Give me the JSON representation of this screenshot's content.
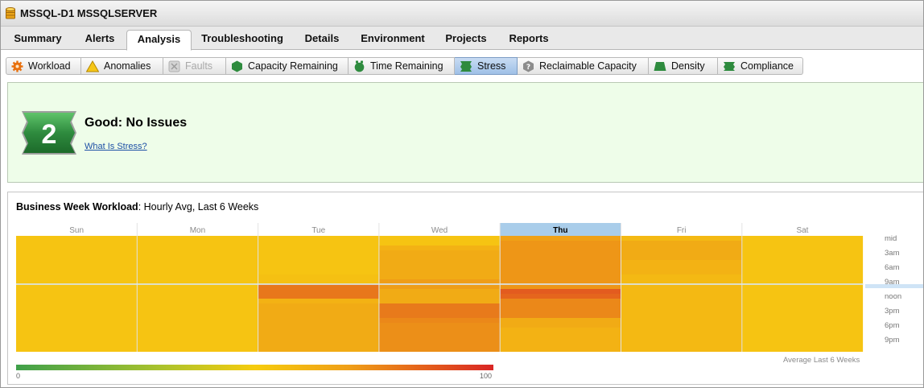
{
  "window": {
    "title": "MSSQL-D1 MSSQLSERVER",
    "icon": "database-icon"
  },
  "main_tabs": [
    {
      "label": "Summary",
      "active": false
    },
    {
      "label": "Alerts",
      "active": false
    },
    {
      "label": "Analysis",
      "active": true
    },
    {
      "label": "Troubleshooting",
      "active": false
    },
    {
      "label": "Details",
      "active": false
    },
    {
      "label": "Environment",
      "active": false
    },
    {
      "label": "Projects",
      "active": false
    },
    {
      "label": "Reports",
      "active": false
    }
  ],
  "sub_tabs": [
    {
      "label": "Workload",
      "icon": "workload-gear-icon",
      "active": false,
      "disabled": false
    },
    {
      "label": "Anomalies",
      "icon": "anomalies-warning-icon",
      "active": false,
      "disabled": false
    },
    {
      "label": "Faults",
      "icon": "faults-icon",
      "active": false,
      "disabled": true
    },
    {
      "label": "Capacity Remaining",
      "icon": "capacity-remaining-icon",
      "active": false,
      "disabled": false
    },
    {
      "label": "Time Remaining",
      "icon": "time-remaining-icon",
      "active": false,
      "disabled": false
    },
    {
      "label": "Stress",
      "icon": "stress-icon",
      "active": true,
      "disabled": false
    },
    {
      "label": "Reclaimable Capacity",
      "icon": "reclaimable-capacity-icon",
      "active": false,
      "disabled": false
    },
    {
      "label": "Density",
      "icon": "density-icon",
      "active": false,
      "disabled": false
    },
    {
      "label": "Compliance",
      "icon": "compliance-icon",
      "active": false,
      "disabled": false
    }
  ],
  "status": {
    "score": "2",
    "headline": "Good: No Issues",
    "link": "What Is Stress?",
    "colors": {
      "panel_bg": "#eefde9",
      "badge": "#2e8b3e"
    }
  },
  "workload": {
    "title_bold": "Business Week Workload",
    "title_rest": ": Hourly Avg, Last 6 Weeks",
    "days": [
      "Sun",
      "Mon",
      "Tue",
      "Wed",
      "Thu",
      "Fri",
      "Sat"
    ],
    "highlight_day": "Thu",
    "hour_labels": [
      "mid",
      "3am",
      "6am",
      "9am",
      "noon",
      "3pm",
      "6pm",
      "9pm"
    ],
    "footer": "Average Last 6 Weeks",
    "legend_min": "0",
    "legend_max": "100",
    "hourly_intensity": {
      "Sun": [
        0.55,
        0.55,
        0.55,
        0.55,
        0.55,
        0.55,
        0.55,
        0.55,
        0.55,
        0.55,
        0.55,
        0.55,
        0.55,
        0.55,
        0.55,
        0.55,
        0.55,
        0.55,
        0.55,
        0.55,
        0.55,
        0.55,
        0.55,
        0.55
      ],
      "Mon": [
        0.55,
        0.55,
        0.55,
        0.55,
        0.55,
        0.55,
        0.55,
        0.55,
        0.55,
        0.55,
        0.55,
        0.55,
        0.55,
        0.55,
        0.55,
        0.55,
        0.55,
        0.55,
        0.55,
        0.55,
        0.55,
        0.55,
        0.55,
        0.55
      ],
      "Tue": [
        0.55,
        0.55,
        0.55,
        0.55,
        0.55,
        0.55,
        0.55,
        0.55,
        0.56,
        0.56,
        0.77,
        0.77,
        0.77,
        0.6,
        0.62,
        0.62,
        0.62,
        0.62,
        0.62,
        0.62,
        0.62,
        0.62,
        0.62,
        0.62
      ],
      "Wed": [
        0.55,
        0.55,
        0.6,
        0.62,
        0.62,
        0.62,
        0.62,
        0.62,
        0.62,
        0.66,
        0.66,
        0.62,
        0.62,
        0.62,
        0.76,
        0.76,
        0.76,
        0.72,
        0.7,
        0.7,
        0.7,
        0.7,
        0.7,
        0.7
      ],
      "Thu": [
        0.65,
        0.68,
        0.68,
        0.68,
        0.68,
        0.68,
        0.68,
        0.68,
        0.68,
        0.68,
        0.68,
        0.85,
        0.82,
        0.72,
        0.72,
        0.72,
        0.72,
        0.62,
        0.62,
        0.6,
        0.6,
        0.6,
        0.6,
        0.6
      ],
      "Fri": [
        0.58,
        0.62,
        0.62,
        0.62,
        0.62,
        0.6,
        0.6,
        0.6,
        0.58,
        0.58,
        0.58,
        0.58,
        0.58,
        0.58,
        0.58,
        0.58,
        0.58,
        0.58,
        0.58,
        0.58,
        0.58,
        0.58,
        0.58,
        0.58
      ],
      "Sat": [
        0.55,
        0.55,
        0.55,
        0.55,
        0.55,
        0.55,
        0.55,
        0.55,
        0.55,
        0.55,
        0.55,
        0.55,
        0.55,
        0.55,
        0.55,
        0.55,
        0.55,
        0.55,
        0.55,
        0.55,
        0.55,
        0.55,
        0.55,
        0.55
      ]
    },
    "colors": {
      "low": "#3fa04a",
      "mid": "#f6c412",
      "high": "#d92625",
      "highlight_header": "#a9cdea"
    }
  }
}
